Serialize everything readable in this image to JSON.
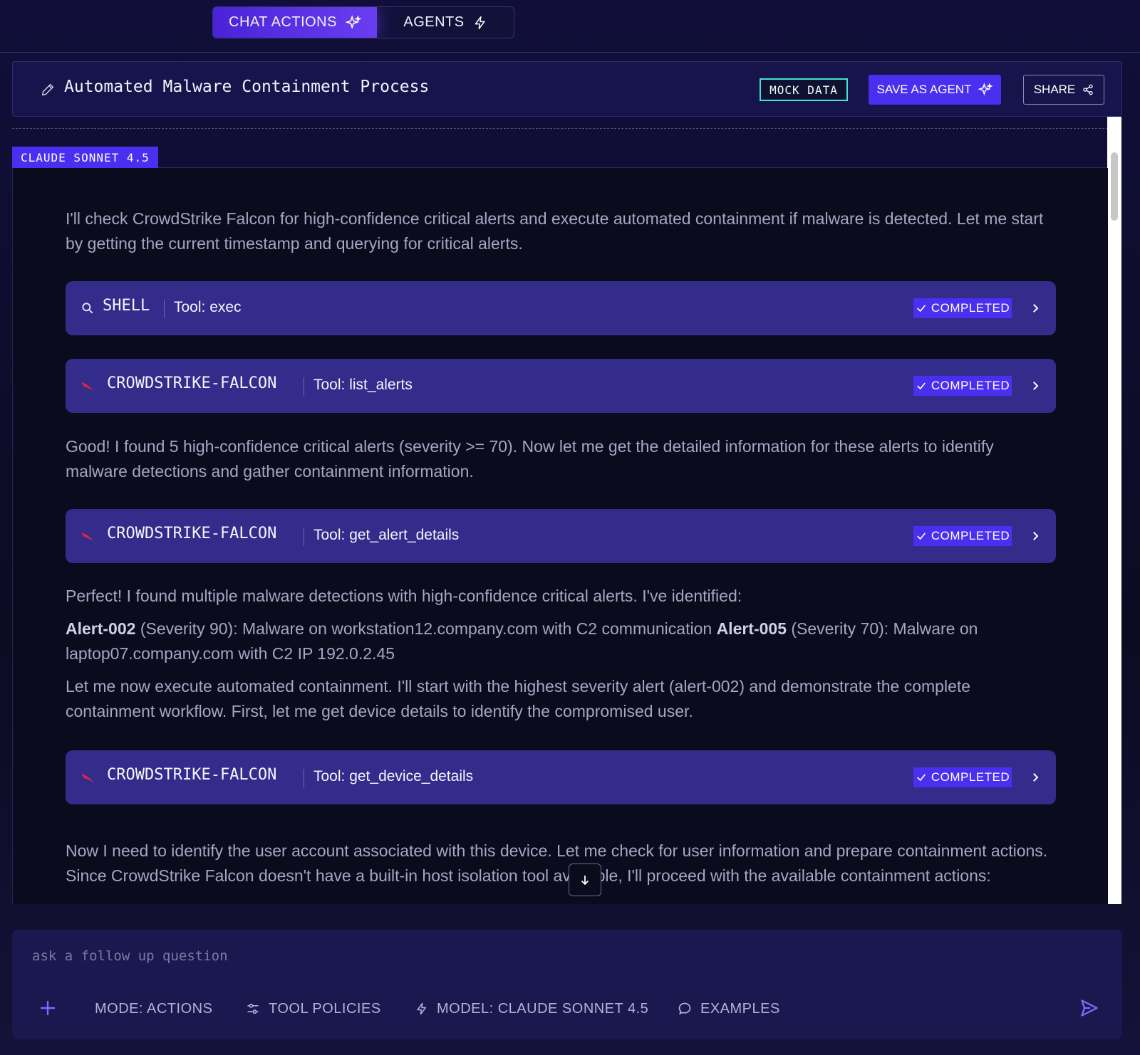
{
  "tabs": [
    {
      "label": "CHAT ACTIONS",
      "icon": "sparkle-icon",
      "active": true
    },
    {
      "label": "AGENTS",
      "icon": "bolt-icon",
      "active": false
    }
  ],
  "header": {
    "title": "Automated Malware Containment Process",
    "mock_badge": "MOCK DATA",
    "save_label": "SAVE AS AGENT",
    "share_label": "SHARE"
  },
  "model_badge": "CLAUDE SONNET 4.5",
  "messages": {
    "intro": "I'll check CrowdStrike Falcon for high-confidence critical alerts and execute automated containment if malware is detected. Let me start by getting the current timestamp and querying for critical alerts.",
    "found_alerts": "Good! I found 5 high-confidence critical alerts (severity >= 70). Now let me get the detailed information for these alerts to identify malware detections and gather containment information.",
    "perfect": "Perfect! I found multiple malware detections with high-confidence critical alerts. I've identified:",
    "alert_002_label": "Alert-002",
    "alert_002_text": " (Severity 90): Malware on workstation12.company.com with C2 communication ",
    "alert_005_label": "Alert-005",
    "alert_005_text": " (Severity 70): Malware on laptop07.company.com with C2 IP 192.0.2.45",
    "execute": "Let me now execute automated containment. I'll start with the highest severity alert (alert-002) and demonstrate the complete containment workflow. First, let me get device details to identify the compromised user.",
    "identify_user": "Now I need to identify the user account associated with this device. Let me check for user information and prepare containment actions. Since CrowdStrike Falcon doesn't have a built-in host isolation tool available, I'll proceed with the available containment actions:"
  },
  "tool_calls": [
    {
      "name": "SHELL",
      "tool": "Tool: exec",
      "status": "COMPLETED",
      "icon": "search-icon"
    },
    {
      "name": "CROWDSTRIKE-FALCON",
      "tool": "Tool: list_alerts",
      "status": "COMPLETED",
      "icon": "falcon-icon"
    },
    {
      "name": "CROWDSTRIKE-FALCON",
      "tool": "Tool: get_alert_details",
      "status": "COMPLETED",
      "icon": "falcon-icon"
    },
    {
      "name": "CROWDSTRIKE-FALCON",
      "tool": "Tool: get_device_details",
      "status": "COMPLETED",
      "icon": "falcon-icon"
    }
  ],
  "composer": {
    "placeholder": "ask a follow up question",
    "mode_label": "MODE: ACTIONS",
    "policies_label": "TOOL POLICIES",
    "model_label": "MODEL: CLAUDE SONNET 4.5",
    "examples_label": "EXAMPLES"
  },
  "colors": {
    "accent": "#4b2ff0",
    "tool_card": "#332c8a",
    "mock_border": "#3ee6d0",
    "falcon_red": "#e0283a"
  }
}
